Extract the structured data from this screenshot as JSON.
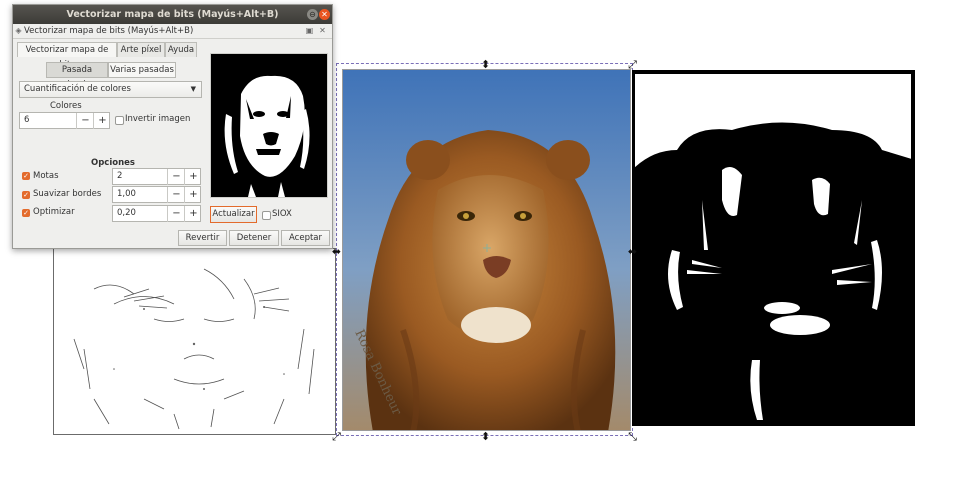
{
  "dialog": {
    "title": "Vectorizar mapa de bits (Mayús+Alt+B)",
    "subtitle": "Vectorizar mapa de bits (Mayús+Alt+B)",
    "tabs": [
      {
        "label": "Vectorizar mapa de bits",
        "active": true
      },
      {
        "label": "Arte píxel",
        "active": false
      },
      {
        "label": "Ayuda",
        "active": false
      }
    ],
    "modes": [
      {
        "label": "Pasada simple",
        "active": true
      },
      {
        "label": "Varias pasadas",
        "active": false
      }
    ],
    "method_select": "Cuantificación de colores",
    "colors_label": "Colores",
    "colors_value": "6",
    "invert_label": "Invertir imagen",
    "invert_checked": false,
    "options_label": "Opciones",
    "options": [
      {
        "label": "Motas",
        "value": "2",
        "checked": true
      },
      {
        "label": "Suavizar bordes",
        "value": "1,00",
        "checked": true
      },
      {
        "label": "Optimizar",
        "value": "0,20",
        "checked": true
      }
    ],
    "update_button": "Actualizar",
    "siox_label": "SIOX",
    "siox_checked": false,
    "buttons": {
      "revert": "Revertir",
      "stop": "Detener",
      "accept": "Aceptar"
    }
  },
  "canvas": {
    "signature_text": "Rosa Bonheur"
  },
  "colors": {
    "titlebar": "#3c3b37",
    "accent_checkbox": "#e36b2c",
    "close_button": "#e95420",
    "selection_dash": "#7a6fb8"
  }
}
